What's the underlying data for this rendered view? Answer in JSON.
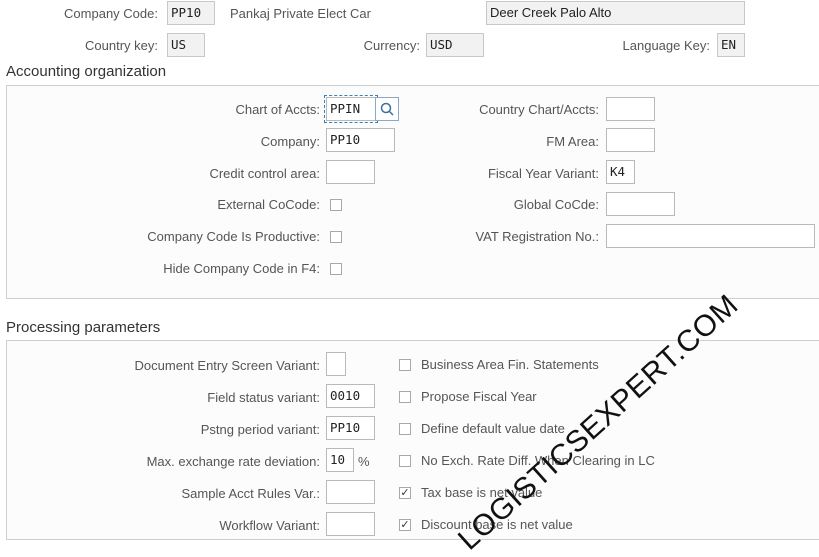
{
  "header": {
    "company_code_label": "Company Code:",
    "company_code": "PP10",
    "company_name": "Pankaj Private Elect Car",
    "city": "Deer Creek Palo Alto",
    "country_key_label": "Country key:",
    "country_key": "US",
    "currency_label": "Currency:",
    "currency": "USD",
    "language_key_label": "Language Key:",
    "language_key": "EN"
  },
  "accounting": {
    "title": "Accounting organization",
    "chart_of_accts_label": "Chart of Accts:",
    "chart_of_accts": "PPIN",
    "company_label": "Company:",
    "company": "PP10",
    "credit_control_label": "Credit control area:",
    "credit_control": "",
    "external_cocode_label": "External CoCode:",
    "productive_label": "Company Code Is Productive:",
    "hide_f4_label": "Hide Company Code in F4:",
    "country_chart_label": "Country Chart/Accts:",
    "country_chart": "",
    "fm_area_label": "FM Area:",
    "fm_area": "",
    "fiscal_year_variant_label": "Fiscal Year Variant:",
    "fiscal_year_variant": "K4",
    "global_cocode_label": "Global CoCde:",
    "global_cocode": "",
    "vat_reg_label": "VAT Registration No.:",
    "vat_reg": ""
  },
  "processing": {
    "title": "Processing parameters",
    "doc_entry_label": "Document Entry Screen Variant:",
    "doc_entry": "",
    "field_status_label": "Field status variant:",
    "field_status": "0010",
    "pstng_period_label": "Pstng period variant:",
    "pstng_period": "PP10",
    "max_exch_label": "Max. exchange rate deviation:",
    "max_exch": "10",
    "max_exch_unit": "%",
    "sample_acct_label": "Sample Acct Rules Var.:",
    "sample_acct": "",
    "workflow_label": "Workflow Variant:",
    "workflow": "",
    "checkboxes": [
      {
        "label": "Business Area Fin. Statements",
        "checked": false
      },
      {
        "label": "Propose Fiscal Year",
        "checked": false
      },
      {
        "label": "Define default value date",
        "checked": false
      },
      {
        "label": "No Exch. Rate Diff. When Clearing in LC",
        "checked": false
      },
      {
        "label": "Tax base is net value",
        "checked": true
      },
      {
        "label": "Discount base is net value",
        "checked": true
      }
    ]
  },
  "watermark": "LOGISTICSEXPERT.COM"
}
